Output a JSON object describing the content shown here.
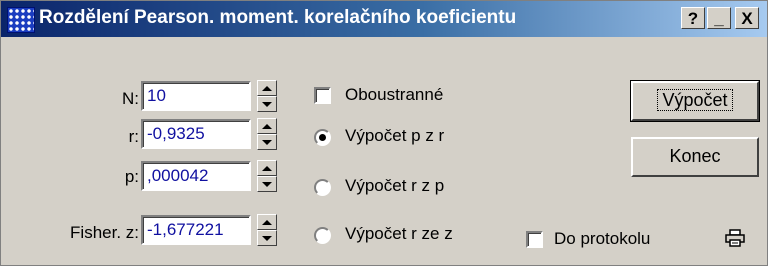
{
  "window": {
    "title": "Rozdělení Pearson. moment. korelačního koeficientu",
    "help_label": "?",
    "minimize_label": "_",
    "close_label": "X"
  },
  "fields": [
    {
      "label": "N:",
      "value": "10"
    },
    {
      "label": "r:",
      "value": "-0,9325"
    },
    {
      "label": "p:",
      "value": ",000042"
    },
    {
      "label": "Fisher. z:",
      "value": "-1,677221"
    }
  ],
  "options": {
    "two_sided_label": "Oboustranné",
    "two_sided_checked": false,
    "radios": [
      {
        "label": "Výpočet p z r",
        "selected": true
      },
      {
        "label": "Výpočet r z p",
        "selected": false
      },
      {
        "label": "Výpočet r ze z",
        "selected": false
      }
    ],
    "protocol_label": "Do protokolu",
    "protocol_checked": false
  },
  "buttons": {
    "compute_label": "Výpočet",
    "end_label": "Konec"
  },
  "icons": {
    "app": "grid-app-icon",
    "printer": "printer-icon"
  }
}
